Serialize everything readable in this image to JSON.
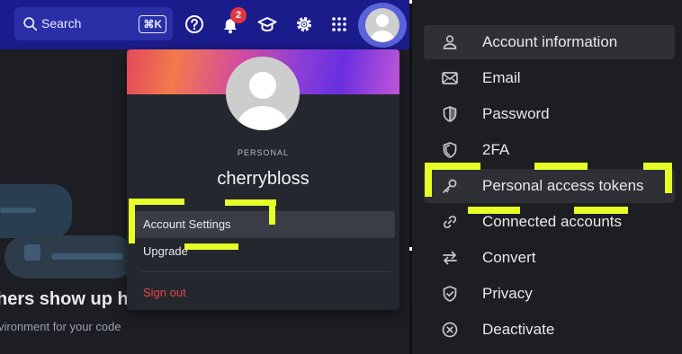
{
  "topbar": {
    "search_label": "Search",
    "search_shortcut": "⌘K",
    "notification_count": "2",
    "icons": [
      "search-icon",
      "help-icon",
      "bell-icon",
      "graduation-cap-icon",
      "gear-icon",
      "apps-grid-icon",
      "avatar-icon"
    ]
  },
  "background": {
    "heading": "hers show up her",
    "subtext": "vironment for your code"
  },
  "dropdown": {
    "account_type": "PERSONAL",
    "username": "cherrybloss",
    "items": [
      {
        "label": "Account Settings",
        "active": true
      },
      {
        "label": "Upgrade",
        "active": false
      }
    ],
    "sign_out": "Sign out"
  },
  "settings_menu": {
    "items": [
      {
        "label": "Account information",
        "icon": "person-icon",
        "active": true
      },
      {
        "label": "Email",
        "icon": "mail-icon",
        "active": false
      },
      {
        "label": "Password",
        "icon": "shield-icon",
        "active": false
      },
      {
        "label": "2FA",
        "icon": "shield-outline-icon",
        "active": false
      },
      {
        "label": "Personal access tokens",
        "icon": "key-icon",
        "active": true
      },
      {
        "label": "Connected accounts",
        "icon": "link-icon",
        "active": false
      },
      {
        "label": "Convert",
        "icon": "swap-arrows-icon",
        "active": false
      },
      {
        "label": "Privacy",
        "icon": "shield-check-icon",
        "active": false
      },
      {
        "label": "Deactivate",
        "icon": "x-circle-icon",
        "active": false
      }
    ]
  },
  "colors": {
    "topbar": "#1b1c8c",
    "highlight": "#e6ff28",
    "sign_out": "#e0474f",
    "badge": "#e0353f"
  }
}
